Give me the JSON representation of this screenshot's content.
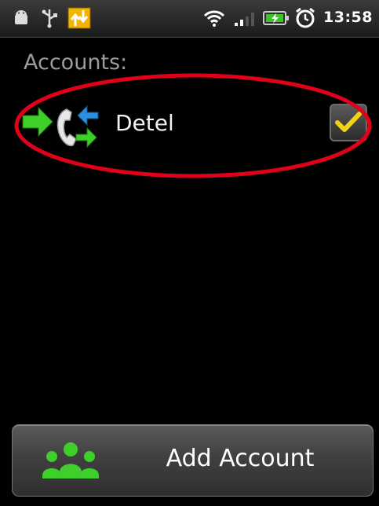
{
  "status_bar": {
    "time": "13:58",
    "icons": [
      "android-debug-icon",
      "usb-icon",
      "sync-notification-icon",
      "wifi-icon",
      "signal-icon",
      "battery-charging-icon",
      "alarm-clock-icon"
    ]
  },
  "accounts": {
    "header": "Accounts:",
    "items": [
      {
        "name": "Detel",
        "checked": true
      }
    ]
  },
  "add_account": {
    "label": "Add Account"
  },
  "colors": {
    "highlight": "#e0001a",
    "check": "#f2d11a",
    "green_arrow": "#3fcf2a",
    "blue_arrow": "#2a8fe0"
  }
}
